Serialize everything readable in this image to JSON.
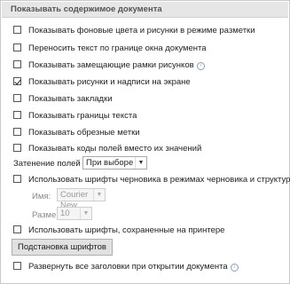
{
  "header": {
    "title": "Показывать содержимое документа"
  },
  "options": [
    {
      "label": "Показывать фоновые цвета и рисунки в режиме разметки",
      "checked": false
    },
    {
      "label": "Переносить текст по границе окна документа",
      "checked": false
    },
    {
      "label": "Показывать замещающие рамки рисунков",
      "checked": false
    },
    {
      "label": "Показывать рисунки и надписи на экране",
      "checked": true
    },
    {
      "label": "Показывать закладки",
      "checked": false
    },
    {
      "label": "Показывать границы текста",
      "checked": false
    },
    {
      "label": "Показывать обрезные метки",
      "checked": false
    },
    {
      "label": "Показывать коды полей вместо их значений",
      "checked": false
    }
  ],
  "field_shading": {
    "label": "Затенение полей",
    "value": "При выборе"
  },
  "draft_fonts": {
    "label": "Использовать шрифты черновика в режимах черновика и структуры",
    "checked": false,
    "name_label": "Имя:",
    "name_value": "Courier New",
    "size_label": "Размер:",
    "size_value": "10"
  },
  "printer_fonts": {
    "label": "Использовать шрифты, сохраненные на принтере",
    "checked": false
  },
  "font_substitution_button": "Подстановка шрифтов",
  "expand_headings": {
    "label": "Развернуть все заголовки при открытии документа",
    "checked": false
  },
  "icons": {
    "info": "info-icon",
    "dropdown": "chevron-down-icon"
  },
  "info_glyph": "i",
  "arrow_glyph": "▼"
}
